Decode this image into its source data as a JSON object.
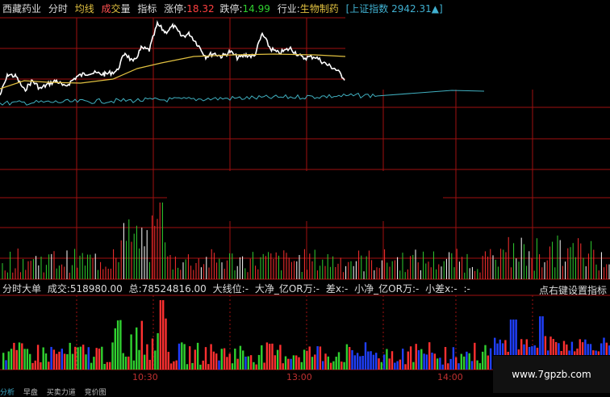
{
  "header": {
    "stock_name": "西藏药业",
    "tab_fenshi": "分时",
    "tab_junxian": "均线",
    "tab_chengjiao": "成交量",
    "tab_zhibiao": "指标",
    "limit_up_label": "涨停:",
    "limit_up_value": "18.32",
    "limit_down_label": "跌停:",
    "limit_down_value": "14.99",
    "industry_label": "行业:",
    "industry_value": "生物制药",
    "index_text": "[上证指数 2942.31▲]"
  },
  "indicator_bar": {
    "name": "分时大单",
    "volume": "成交:518980.00",
    "total": "总:78524816.00",
    "big_line": "大线位:-",
    "big_net": "大净_亿OR万:-",
    "diff1": "差x:-",
    "small_net": "小净_亿OR万:-",
    "small_diff": "小差x:-",
    "tail": ":-",
    "right_hint": "点右键设置指标"
  },
  "time_axis": [
    "10:30",
    "13:00",
    "14:00"
  ],
  "bottom_tabs": [
    "分析",
    "早盘",
    "买卖力道",
    "竞价图"
  ],
  "watermark": "www.7gpzb.com",
  "colors": {
    "background": "#000000",
    "grid": "#a01010",
    "price_line": "#ffffff",
    "avg_line": "#e0c040",
    "teal_line": "#40b0c0",
    "up_bar": "#ff3030",
    "down_bar": "#30d030",
    "neutral_bar": "#ffffff",
    "blue_bar": "#2040ff"
  }
}
